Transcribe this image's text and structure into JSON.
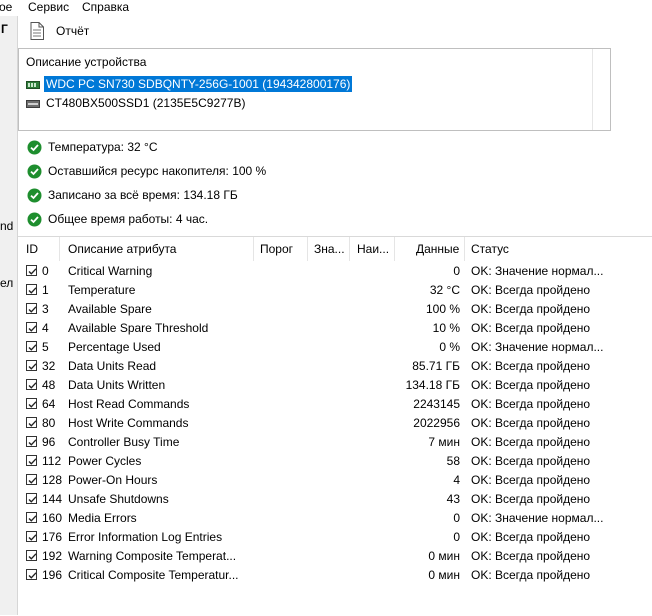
{
  "menu": {
    "file_fragment": "ое",
    "service": "Сервис",
    "help": "Справка"
  },
  "left_fragments": [
    "Г",
    "nd",
    "ел"
  ],
  "toolbar": {
    "report_label": "Отчёт"
  },
  "devices": {
    "header": "Описание устройства",
    "items": [
      {
        "label": "WDC PC SN730 SDBQNTY-256G-1001 (194342800176)",
        "selected": true
      },
      {
        "label": "CT480BX500SSD1 (2135E5C9277B)",
        "selected": false
      }
    ]
  },
  "status_lines": [
    "Температура: 32 °C",
    "Оставшийся ресурс накопителя: 100 %",
    "Записано за всё время: 134.18 ГБ",
    "Общее время работы: 4 час."
  ],
  "table": {
    "headers": [
      "ID",
      "Описание атрибута",
      "Порог",
      "Зна...",
      "Наи...",
      "Данные",
      "Статус"
    ],
    "rows": [
      {
        "id": "0",
        "name": "Critical Warning",
        "data": "0",
        "status": "OK: Значение нормал..."
      },
      {
        "id": "1",
        "name": "Temperature",
        "data": "32 °C",
        "status": "OK: Всегда пройдено"
      },
      {
        "id": "3",
        "name": "Available Spare",
        "data": "100 %",
        "status": "OK: Всегда пройдено"
      },
      {
        "id": "4",
        "name": "Available Spare Threshold",
        "data": "10 %",
        "status": "OK: Всегда пройдено"
      },
      {
        "id": "5",
        "name": "Percentage Used",
        "data": "0 %",
        "status": "OK: Значение нормал..."
      },
      {
        "id": "32",
        "name": "Data Units Read",
        "data": "85.71 ГБ",
        "status": "OK: Всегда пройдено"
      },
      {
        "id": "48",
        "name": "Data Units Written",
        "data": "134.18 ГБ",
        "status": "OK: Всегда пройдено"
      },
      {
        "id": "64",
        "name": "Host Read Commands",
        "data": "2243145",
        "status": "OK: Всегда пройдено"
      },
      {
        "id": "80",
        "name": "Host Write Commands",
        "data": "2022956",
        "status": "OK: Всегда пройдено"
      },
      {
        "id": "96",
        "name": "Controller Busy Time",
        "data": "7 мин",
        "status": "OK: Всегда пройдено"
      },
      {
        "id": "112",
        "name": "Power Cycles",
        "data": "58",
        "status": "OK: Всегда пройдено"
      },
      {
        "id": "128",
        "name": "Power-On Hours",
        "data": "4",
        "status": "OK: Всегда пройдено"
      },
      {
        "id": "144",
        "name": "Unsafe Shutdowns",
        "data": "43",
        "status": "OK: Всегда пройдено"
      },
      {
        "id": "160",
        "name": "Media Errors",
        "data": "0",
        "status": "OK: Значение нормал..."
      },
      {
        "id": "176",
        "name": "Error Information Log Entries",
        "data": "0",
        "status": "OK: Всегда пройдено"
      },
      {
        "id": "192",
        "name": "Warning Composite Temperat...",
        "data": "0 мин",
        "status": "OK: Всегда пройдено"
      },
      {
        "id": "196",
        "name": "Critical Composite Temperatur...",
        "data": "0 мин",
        "status": "OK: Всегда пройдено"
      }
    ]
  },
  "icons": {
    "report": "document-icon",
    "status": "ok-check-icon",
    "device": "drive-icon",
    "row": "checkbox-icon"
  },
  "colors": {
    "selection": "#0078d7",
    "ok_green": "#1e8e2e",
    "border": "#bfbfbf"
  }
}
